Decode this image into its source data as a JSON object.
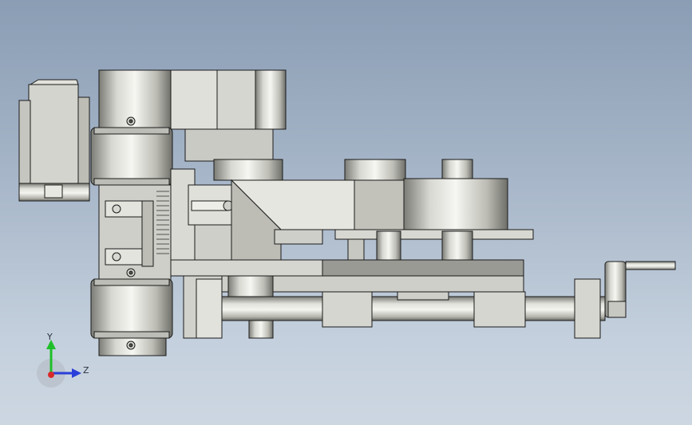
{
  "viewport": {
    "background_top": "#8a9db4",
    "background_bottom": "#cdd7e2"
  },
  "triad": {
    "y_label": "Y",
    "z_label": "Z",
    "y_color": "#1fbf2a",
    "z_color": "#2a3fd9",
    "x_color": "#d92a2a"
  },
  "model": {
    "steel_light": "#ececec",
    "steel_mid": "#c9c9c3",
    "steel_dark": "#8e8e88",
    "edge_color": "#1a1a1a",
    "components": [
      "motor-gearbox",
      "upper-roller",
      "lower-roller",
      "drive-gear-housing",
      "slide-block",
      "press-ram",
      "guide-rail",
      "lead-screw",
      "hand-crank"
    ]
  }
}
